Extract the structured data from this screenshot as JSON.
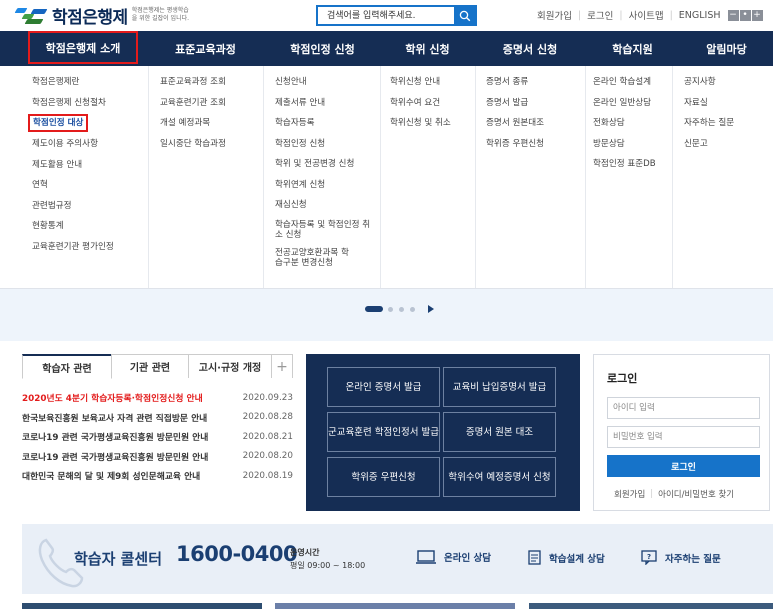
{
  "header": {
    "logo_text": "학점은행제",
    "logo_sub": "학점은행제는 평생학습을 위한 길잡이 입니다.",
    "search_placeholder": "검색어를 입력해주세요.",
    "util_links": [
      "회원가입",
      "로그인",
      "사이트맵",
      "ENGLISH"
    ],
    "lang_buttons": [
      "−",
      "•",
      "+"
    ]
  },
  "gnb": [
    "학점은행제 소개",
    "표준교육과정",
    "학점인정 신청",
    "학위 신청",
    "증명서 신청",
    "학습지원",
    "알림마당"
  ],
  "mega": [
    [
      "학점은행제란",
      "학점은행제 신청절차",
      "학점인정 대상",
      "제도이용 주의사항",
      "제도활용 안내",
      "연혁",
      "관련법규정",
      "현황통계",
      "교육훈련기관 평가인정"
    ],
    [
      "표준교육과정 조회",
      "교육훈련기관 조회",
      "개설 예정과목",
      "일시중단 학습과정"
    ],
    [
      "신청안내",
      "제출서류 안내",
      "학습자등록",
      "학점인정 신청",
      "학위 및 전공변경 신청",
      "학위연계 신청",
      "재심신청",
      "학습자등록 및 학점인정 취소 신청",
      "전공교양호환과목 학습구분 변경신청"
    ],
    [
      "학위신청 안내",
      "학위수여 요건",
      "학위신청 및 취소"
    ],
    [
      "증명서 종류",
      "증명서 발급",
      "증명서 원본대조",
      "학위증 우편신청"
    ],
    [
      "온라인 학습설계",
      "온라인 일반상담",
      "전화상담",
      "방문상담",
      "학점인정 표준DB"
    ],
    [
      "공지사항",
      "자료실",
      "자주하는 질문",
      "신문고"
    ]
  ],
  "board": {
    "tabs": [
      "학습자 관련",
      "기관 관련",
      "고시·규정 개정",
      "+"
    ],
    "items": [
      {
        "title": "2020년도 4분기 학습자등록·학점인정신청 안내",
        "date": "2020.09.23"
      },
      {
        "title": "한국보육진흥원 보육교사 자격 관련 직접방문 안내",
        "date": "2020.08.28"
      },
      {
        "title": "코로나19 관련 국가평생교육진흥원 방문민원 안내",
        "date": "2020.08.21"
      },
      {
        "title": "코로나19 관련 국가평생교육진흥원 방문민원 안내",
        "date": "2020.08.20"
      },
      {
        "title": "대한민국 문해의 달 및 제9회 성인문해교육 안내",
        "date": "2020.08.19"
      }
    ]
  },
  "quick": [
    "온라인 증명서 발급",
    "교육비 납입증명서 발급",
    "군교육훈련 학점인정서 발급",
    "증명서 원본 대조",
    "학위증 우편신청",
    "학위수여 예정증명서 신청"
  ],
  "login": {
    "title": "로그인",
    "id_placeholder": "아이디 입력",
    "pw_placeholder": "비밀번호 입력",
    "button": "로그인",
    "links": [
      "회원가입",
      "아이디/비밀번호 찾기"
    ]
  },
  "callcenter": {
    "title": "학습자 콜센터",
    "number": "1600-0400",
    "hours_label": "운영시간",
    "hours": "평일 09:00 ~ 18:00",
    "links": [
      "온라인 상담",
      "학습설계 상담",
      "자주하는 질문"
    ]
  },
  "colors": {
    "navy": "#152d54",
    "blue": "#1673c9",
    "highlight": "#e31b1b"
  }
}
